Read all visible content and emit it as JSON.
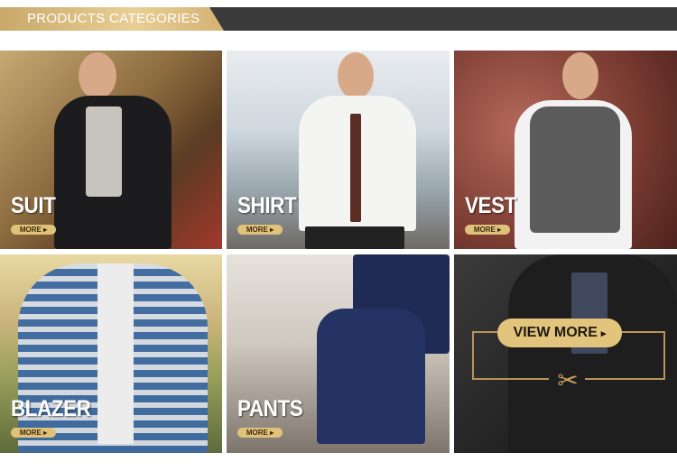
{
  "banner": {
    "title": "PRODUCTS CATEGORIES"
  },
  "categories": [
    {
      "name": "SUIT",
      "more": "MORE ▸"
    },
    {
      "name": "SHIRT",
      "more": "MORE ▸"
    },
    {
      "name": "VEST",
      "more": "MORE ▸"
    },
    {
      "name": "BLAZER",
      "more": "MORE ▸"
    },
    {
      "name": "PANTS",
      "more": "MORE ▸"
    }
  ],
  "view_more": {
    "label": "VIEW MORE",
    "arrow": "▸",
    "icon": "scissors-icon"
  }
}
